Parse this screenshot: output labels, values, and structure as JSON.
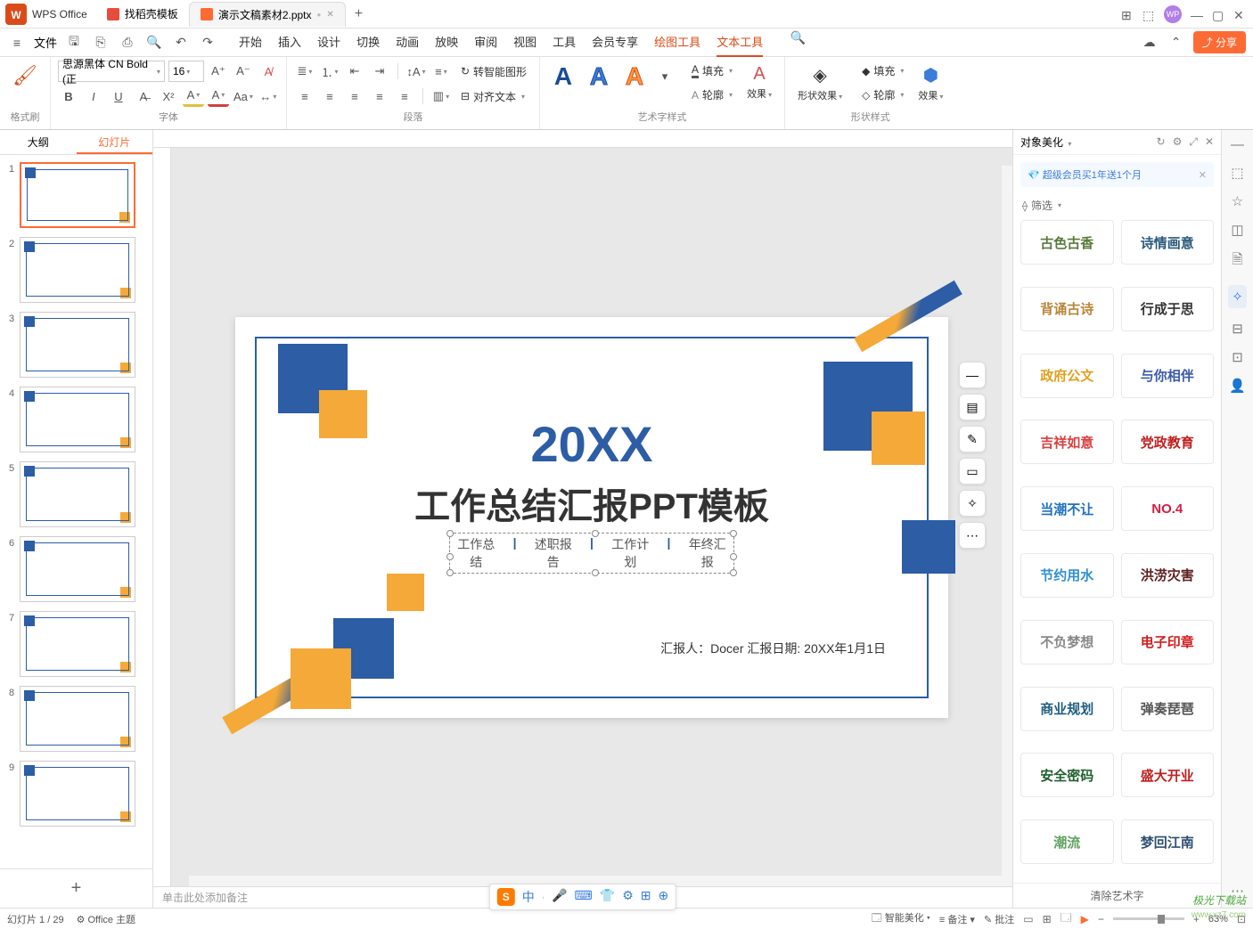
{
  "titlebar": {
    "app_name": "WPS Office",
    "tabs": [
      {
        "label": "找稻壳模板",
        "icon_color": "#e84c3d"
      },
      {
        "label": "演示文稿素材2.pptx",
        "icon_color": "#fd6b35"
      }
    ],
    "add": "+"
  },
  "window_controls": {
    "min": "—",
    "restore": "▢",
    "close": "✕"
  },
  "menubar": {
    "file": "文件",
    "tabs": [
      "开始",
      "插入",
      "设计",
      "切换",
      "动画",
      "放映",
      "审阅",
      "视图",
      "工具",
      "会员专享"
    ],
    "context_tabs": [
      "绘图工具",
      "文本工具"
    ],
    "active": "文本工具",
    "share": "分享"
  },
  "ribbon": {
    "format_painter": "格式刷",
    "font_group": "字体",
    "font_name": "思源黑体 CN Bold (正",
    "font_size": "16",
    "para_group": "段落",
    "smart_shape": "转智能图形",
    "wordart_group": "艺术字样式",
    "shape_style_group": "形状样式",
    "fill": "填充",
    "outline": "轮廓",
    "effects": "效果",
    "shape_effects": "形状效果",
    "align_text": "对齐文本"
  },
  "slide_panel": {
    "tabs": {
      "outline": "大纲",
      "slides": "幻灯片"
    },
    "count": 9,
    "add": "+"
  },
  "slide_content": {
    "year": "20XX",
    "title": "工作总结汇报PPT模板",
    "tags": [
      "工作总结",
      "述职报告",
      "工作计划",
      "年终汇报"
    ],
    "sep": "|",
    "author_line": "汇报人：Docer 汇报日期: 20XX年1月1日"
  },
  "float_tools": [
    "—",
    "▤",
    "✎",
    "▭",
    "✧",
    "⋯"
  ],
  "input_toolbar": {
    "sogou": "S",
    "items": [
      "中",
      "🎤",
      "⌨",
      "👕",
      "⚙",
      "⊞",
      "⊕"
    ]
  },
  "notes_placeholder": "单击此处添加备注",
  "right_panel": {
    "title": "对象美化",
    "promo": "超级会员买1年送1个月",
    "promo_close": "✕",
    "filter": "筛选",
    "styles": [
      {
        "t": "古色古香",
        "c": "#5b7a3a",
        "f": "cursive"
      },
      {
        "t": "诗情画意",
        "c": "#2b5a7a",
        "f": "cursive"
      },
      {
        "t": "背诵古诗",
        "c": "#b8863a",
        "f": "cursive"
      },
      {
        "t": "行成于思",
        "c": "#333",
        "f": "cursive"
      },
      {
        "t": "政府公文",
        "c": "#e0a020",
        "f": "bold"
      },
      {
        "t": "与你相伴",
        "c": "#3b5aa8",
        "f": "normal"
      },
      {
        "t": "吉祥如意",
        "c": "#d84040",
        "f": "cursive"
      },
      {
        "t": "党政教育",
        "c": "#c02020",
        "f": "bold"
      },
      {
        "t": "当潮不让",
        "c": "#2070c0",
        "f": "bold"
      },
      {
        "t": "NO.4",
        "c": "#d02040",
        "f": "bold"
      },
      {
        "t": "节约用水",
        "c": "#3090d0",
        "f": "bold"
      },
      {
        "t": "洪涝灾害",
        "c": "#602020",
        "f": "bold"
      },
      {
        "t": "不负梦想",
        "c": "#888",
        "f": "normal"
      },
      {
        "t": "电子印章",
        "c": "#d02020",
        "f": "bold"
      },
      {
        "t": "商业规划",
        "c": "#206080",
        "f": "bold"
      },
      {
        "t": "弹奏琵琶",
        "c": "#555",
        "f": "cursive"
      },
      {
        "t": "安全密码",
        "c": "#206030",
        "f": "bold"
      },
      {
        "t": "盛大开业",
        "c": "#c02020",
        "f": "bold"
      },
      {
        "t": "潮流",
        "c": "#60a060",
        "f": "cursive"
      },
      {
        "t": "梦回江南",
        "c": "#305070",
        "f": "cursive"
      }
    ],
    "clear": "清除艺术字"
  },
  "statusbar": {
    "slide_pos": "幻灯片 1 / 29",
    "theme": "Office 主题",
    "smart_beautify": "智能美化",
    "notes": "备注",
    "comments": "批注",
    "zoom": "63%"
  },
  "watermark": {
    "main": "极光下载站",
    "sub": "www.xz7.com"
  }
}
